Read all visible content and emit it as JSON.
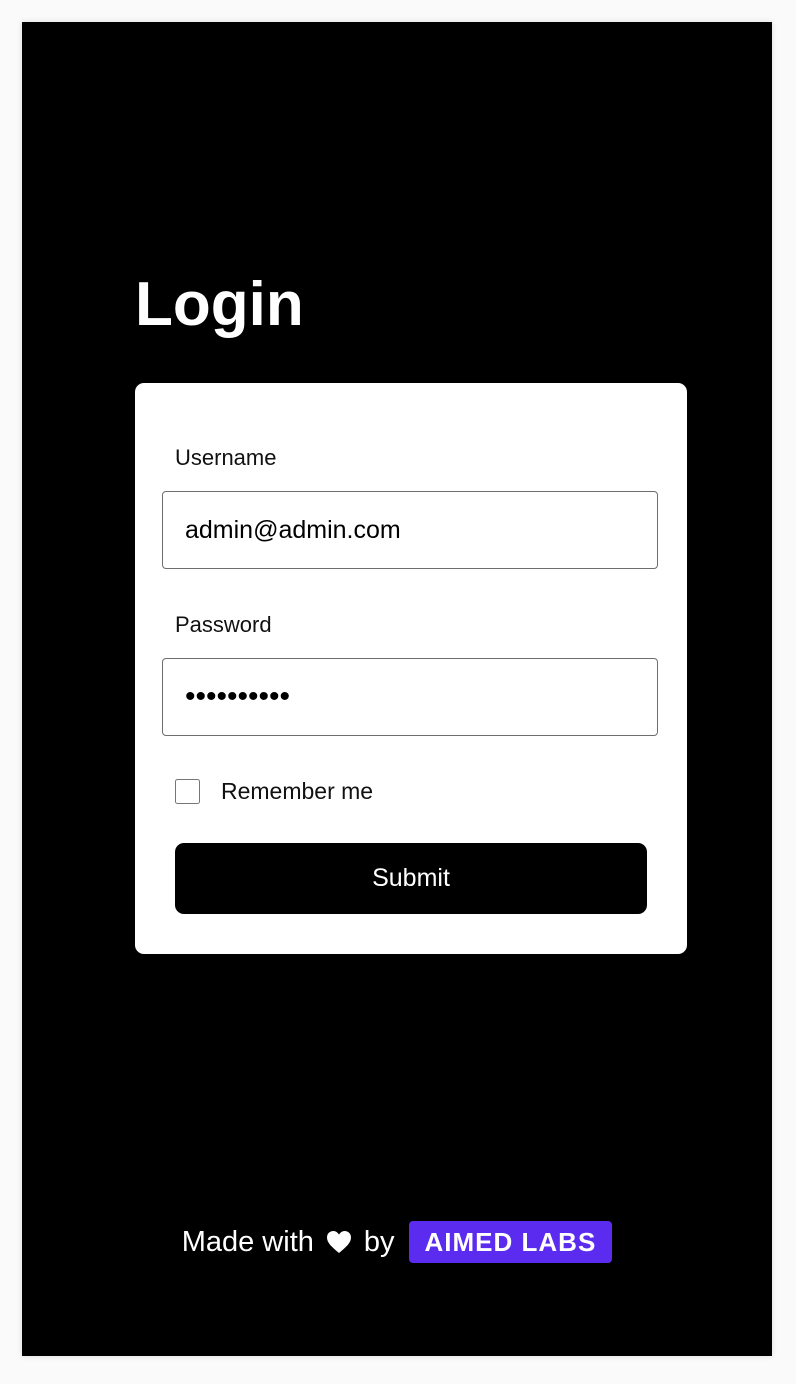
{
  "page": {
    "title": "Login"
  },
  "form": {
    "username_label": "Username",
    "username_value": "admin@admin.com",
    "password_label": "Password",
    "password_value": "••••••••••",
    "remember_label": "Remember me",
    "remember_checked": false,
    "submit_label": "Submit"
  },
  "footer": {
    "made_with": "Made with",
    "by": "by",
    "brand": "AIMED LABS",
    "icon": "heart-icon"
  },
  "colors": {
    "background": "#000000",
    "card": "#ffffff",
    "brand_badge": "#5b2bf0",
    "button": "#000000"
  }
}
